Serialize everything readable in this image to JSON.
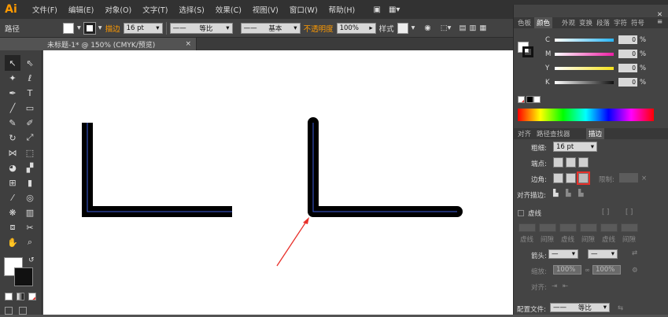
{
  "app": {
    "logo": "Ai"
  },
  "menu": [
    "文件(F)",
    "编辑(E)",
    "对象(O)",
    "文字(T)",
    "选择(S)",
    "效果(C)",
    "视图(V)",
    "窗口(W)",
    "帮助(H)"
  ],
  "control_bar": {
    "selection_type": "路径",
    "stroke_label": "描边",
    "stroke_weight": "16 pt",
    "profile_label": "等比",
    "brush_label": "基本",
    "opacity_label": "不透明度",
    "opacity_value": "100%",
    "style_label": "样式"
  },
  "document_tab": {
    "title": "未标题-1* @ 150% (CMYK/预览)",
    "close": "×"
  },
  "color_panel": {
    "tabs": [
      "色板",
      "颜色",
      "外观",
      "变换",
      "段落",
      "字符",
      "符号"
    ],
    "channels": [
      {
        "label": "C",
        "value": "0",
        "unit": "%",
        "track": "#29b6f6"
      },
      {
        "label": "M",
        "value": "0",
        "unit": "%",
        "track": "#ec1fa4"
      },
      {
        "label": "Y",
        "value": "0",
        "unit": "%",
        "track": "#f5e21b"
      },
      {
        "label": "K",
        "value": "0",
        "unit": "%",
        "track": "#111111"
      }
    ]
  },
  "stroke_panel": {
    "tabs": [
      "对齐",
      "路径查找器",
      "描边"
    ],
    "weight_label": "粗细:",
    "weight_value": "16 pt",
    "cap_label": "端点:",
    "corner_label": "边角:",
    "limit_label": "限制:",
    "align_label": "对齐描边:",
    "dashed_label": "虚线",
    "dash_cells": [
      "虚线",
      "间隙",
      "虚线",
      "间隙",
      "虚线",
      "间隙"
    ],
    "arrow_label": "箭头:",
    "scale_label": "缩放:",
    "scale_values": [
      "100%",
      "100%"
    ],
    "align2_label": "对齐:",
    "profile_label": "配置文件:",
    "profile_value": "等比"
  },
  "colors": {
    "accent": "#ff9a00",
    "highlight": "#e8302a",
    "path_anchor": "#3b5bdb"
  }
}
